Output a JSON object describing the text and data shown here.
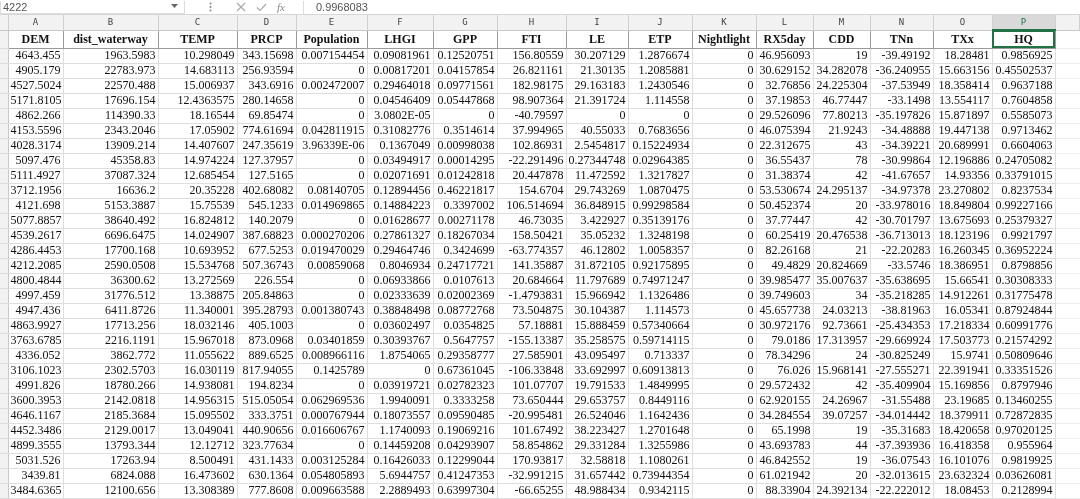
{
  "formula_bar": {
    "cell_ref": "4222",
    "function_label": "fx",
    "value": "0.9968083"
  },
  "columns": [
    {
      "letter": "A",
      "header": "DEM",
      "selected": false
    },
    {
      "letter": "B",
      "header": "dist_waterway",
      "selected": false
    },
    {
      "letter": "C",
      "header": "TEMP",
      "selected": false
    },
    {
      "letter": "D",
      "header": "PRCP",
      "selected": false
    },
    {
      "letter": "E",
      "header": "Population",
      "selected": false
    },
    {
      "letter": "F",
      "header": "LHGI",
      "selected": false
    },
    {
      "letter": "G",
      "header": "GPP",
      "selected": false
    },
    {
      "letter": "H",
      "header": "FTI",
      "selected": false
    },
    {
      "letter": "I",
      "header": "LE",
      "selected": false
    },
    {
      "letter": "J",
      "header": "ETP",
      "selected": false
    },
    {
      "letter": "K",
      "header": "Nightlight",
      "selected": false
    },
    {
      "letter": "L",
      "header": "RX5day",
      "selected": false
    },
    {
      "letter": "M",
      "header": "CDD",
      "selected": false
    },
    {
      "letter": "N",
      "header": "TNn",
      "selected": false
    },
    {
      "letter": "O",
      "header": "TXx",
      "selected": false
    },
    {
      "letter": "P",
      "header": "HQ",
      "selected": true
    }
  ],
  "rows": [
    [
      "4643.455",
      "1963.5983",
      "10.298049",
      "343.15698",
      "0.007154454",
      "0.09081961",
      "0.12520751",
      "156.80559",
      "30.207129",
      "1.2876674",
      "0",
      "46.956093",
      "19",
      "-39.49192",
      "18.28481",
      "0.9856925"
    ],
    [
      "4905.179",
      "22783.973",
      "14.683113",
      "256.93594",
      "0",
      "0.00817201",
      "0.04157854",
      "26.821161",
      "21.30135",
      "1.2085881",
      "0",
      "30.629152",
      "34.282078",
      "-36.240955",
      "15.663156",
      "0.45502537"
    ],
    [
      "4527.5024",
      "22570.488",
      "15.006937",
      "343.6916",
      "0.002472007",
      "0.29464018",
      "0.09771561",
      "182.98175",
      "29.163183",
      "1.2430546",
      "0",
      "32.76856",
      "24.225304",
      "-37.53949",
      "18.358414",
      "0.9637188"
    ],
    [
      "5171.8105",
      "17696.154",
      "12.4363575",
      "280.14658",
      "0",
      "0.04546409",
      "0.05447868",
      "98.907364",
      "21.391724",
      "1.114558",
      "0",
      "37.19853",
      "46.77447",
      "-33.1498",
      "13.554117",
      "0.7604858"
    ],
    [
      "4862.266",
      "114390.33",
      "18.16544",
      "69.85474",
      "0",
      "3.0802E-05",
      "0",
      "-40.79597",
      "0",
      "0",
      "0",
      "29.526096",
      "77.80213",
      "-35.197826",
      "15.871897",
      "0.5585073"
    ],
    [
      "4153.5596",
      "2343.2046",
      "17.05902",
      "774.61694",
      "0.042811915",
      "0.31082776",
      "0.3514614",
      "37.994965",
      "40.55033",
      "0.7683656",
      "0",
      "46.075394",
      "21.9243",
      "-34.48888",
      "19.447138",
      "0.9713462"
    ],
    [
      "4028.3174",
      "13909.214",
      "14.407607",
      "247.35619",
      "3.96339E-06",
      "0.1367049",
      "0.00998038",
      "102.86931",
      "2.5454817",
      "0.15224934",
      "0",
      "22.312675",
      "43",
      "-34.39221",
      "20.689991",
      "0.6604063"
    ],
    [
      "5097.476",
      "45358.83",
      "14.974224",
      "127.37957",
      "0",
      "0.03494917",
      "0.00014295",
      "-22.291496",
      "0.27344748",
      "0.02964385",
      "0",
      "36.55437",
      "78",
      "-30.99864",
      "12.196886",
      "0.24705082"
    ],
    [
      "5111.4927",
      "37087.324",
      "12.685454",
      "127.5165",
      "0",
      "0.02071691",
      "0.01242818",
      "20.447878",
      "11.472592",
      "1.3217827",
      "0",
      "31.38374",
      "42",
      "-41.67657",
      "14.93356",
      "0.33791015"
    ],
    [
      "3712.1956",
      "16636.2",
      "20.35228",
      "402.68082",
      "0.08140705",
      "0.12894456",
      "0.46221817",
      "154.6704",
      "29.743269",
      "1.0870475",
      "0",
      "53.530674",
      "24.295137",
      "-34.97378",
      "23.270802",
      "0.8237534"
    ],
    [
      "4121.698",
      "5153.3887",
      "15.75539",
      "545.1233",
      "0.014969865",
      "0.14884223",
      "0.3397002",
      "106.514694",
      "36.848915",
      "0.99298584",
      "0",
      "50.452374",
      "20",
      "-33.978016",
      "18.849804",
      "0.99227166"
    ],
    [
      "5077.8857",
      "38640.492",
      "16.824812",
      "140.2079",
      "0",
      "0.01628677",
      "0.00271178",
      "46.73035",
      "3.422927",
      "0.35139176",
      "0",
      "37.77447",
      "42",
      "-30.701797",
      "13.675693",
      "0.25379327"
    ],
    [
      "4539.2617",
      "6696.6475",
      "14.024907",
      "387.68823",
      "0.000270206",
      "0.27861327",
      "0.18267034",
      "158.50421",
      "35.05232",
      "1.3248198",
      "0",
      "60.25419",
      "20.476538",
      "-36.713013",
      "18.123196",
      "0.9921797"
    ],
    [
      "4286.4453",
      "17700.168",
      "10.693952",
      "677.5253",
      "0.019470029",
      "0.29464746",
      "0.3424699",
      "-63.774357",
      "46.12802",
      "1.0058357",
      "0",
      "82.26168",
      "21",
      "-22.20283",
      "16.260345",
      "0.36952224"
    ],
    [
      "4212.2085",
      "2590.0508",
      "15.534768",
      "507.36743",
      "0.00859068",
      "0.8046934",
      "0.24717721",
      "141.35887",
      "31.872105",
      "0.92175895",
      "0",
      "49.4829",
      "20.824669",
      "-33.5746",
      "18.386951",
      "0.8798856"
    ],
    [
      "4800.4844",
      "36300.62",
      "13.272569",
      "226.554",
      "0",
      "0.06933866",
      "0.0107613",
      "20.684664",
      "11.797689",
      "0.74971247",
      "0",
      "39.985477",
      "35.007637",
      "-35.638695",
      "15.66541",
      "0.30308333"
    ],
    [
      "4997.459",
      "31776.512",
      "13.38875",
      "205.84863",
      "0",
      "0.02333639",
      "0.02002369",
      "-1.4793831",
      "15.966942",
      "1.1326486",
      "0",
      "39.749603",
      "34",
      "-35.218285",
      "14.912261",
      "0.31775478"
    ],
    [
      "4947.436",
      "6411.8726",
      "11.340001",
      "395.28793",
      "0.001380743",
      "0.38848498",
      "0.08772768",
      "73.504875",
      "30.104387",
      "1.114573",
      "0",
      "45.657738",
      "24.03213",
      "-38.81963",
      "16.05341",
      "0.87924844"
    ],
    [
      "4863.9927",
      "17713.256",
      "18.032146",
      "405.1003",
      "0",
      "0.03602497",
      "0.0354825",
      "57.18881",
      "15.888459",
      "0.57340664",
      "0",
      "30.972176",
      "92.73661",
      "-25.434353",
      "17.218334",
      "0.60991776"
    ],
    [
      "3763.6785",
      "2216.1191",
      "15.967018",
      "873.0968",
      "0.03401859",
      "0.30393767",
      "0.5647757",
      "-155.13387",
      "35.258575",
      "0.59714115",
      "0",
      "79.0186",
      "17.313957",
      "-29.669924",
      "17.503773",
      "0.21574292"
    ],
    [
      "4336.052",
      "3862.772",
      "11.055622",
      "889.6525",
      "0.008966116",
      "1.8754065",
      "0.29358777",
      "27.585901",
      "43.095497",
      "0.713337",
      "0",
      "78.34296",
      "24",
      "-30.825249",
      "15.9741",
      "0.50809646"
    ],
    [
      "3106.1023",
      "2302.5703",
      "16.030119",
      "817.94055",
      "0.1425789",
      "0",
      "0.67361045",
      "-106.33848",
      "33.692997",
      "0.60913813",
      "0",
      "76.026",
      "15.968141",
      "-27.555271",
      "22.391941",
      "0.33351526"
    ],
    [
      "4991.826",
      "18780.266",
      "14.938081",
      "194.8234",
      "0",
      "0.03919721",
      "0.02782323",
      "101.07707",
      "19.791533",
      "1.4849995",
      "0",
      "29.572432",
      "42",
      "-35.409904",
      "15.169856",
      "0.8797946"
    ],
    [
      "3600.3953",
      "2142.0818",
      "14.956315",
      "515.05054",
      "0.062969536",
      "1.9940091",
      "0.3333258",
      "73.650444",
      "29.653757",
      "0.8449116",
      "0",
      "62.920155",
      "24.26967",
      "-31.55488",
      "23.19685",
      "0.13460255"
    ],
    [
      "4646.1167",
      "2185.3684",
      "15.095502",
      "333.3751",
      "0.000767944",
      "0.18073557",
      "0.09590485",
      "-20.995481",
      "26.524046",
      "1.1642436",
      "0",
      "34.284554",
      "39.07257",
      "-34.014442",
      "18.379911",
      "0.72872835"
    ],
    [
      "4452.3486",
      "2129.0017",
      "13.049041",
      "440.90656",
      "0.016606767",
      "1.1740093",
      "0.19069216",
      "101.67492",
      "38.223427",
      "1.2701648",
      "0",
      "65.1998",
      "19",
      "-35.31683",
      "18.420658",
      "0.97020125"
    ],
    [
      "4899.3555",
      "13793.344",
      "12.12712",
      "323.77634",
      "0",
      "0.14459208",
      "0.04293907",
      "58.854862",
      "29.331284",
      "1.3255986",
      "0",
      "43.693783",
      "44",
      "-37.393936",
      "16.418358",
      "0.955964"
    ],
    [
      "5031.526",
      "17263.94",
      "8.500491",
      "431.1433",
      "0.003125284",
      "0.16426033",
      "0.12299044",
      "170.93817",
      "32.58818",
      "1.1080261",
      "0",
      "46.842552",
      "19",
      "-36.07543",
      "16.101076",
      "0.9819925"
    ],
    [
      "3439.81",
      "6824.088",
      "16.473602",
      "630.1364",
      "0.054805893",
      "5.6944757",
      "0.41247353",
      "-32.991215",
      "31.657442",
      "0.73944354",
      "0",
      "61.021942",
      "20",
      "-32.013615",
      "23.632324",
      "0.03626081"
    ],
    [
      "3484.6365",
      "12100.656",
      "13.308389",
      "777.8608",
      "0.009663588",
      "2.2889493",
      "0.63997304",
      "-66.65255",
      "48.988434",
      "0.9342115",
      "0",
      "88.33904",
      "24.392134",
      "-22.222012",
      "18.08453",
      "0.2128994"
    ]
  ]
}
